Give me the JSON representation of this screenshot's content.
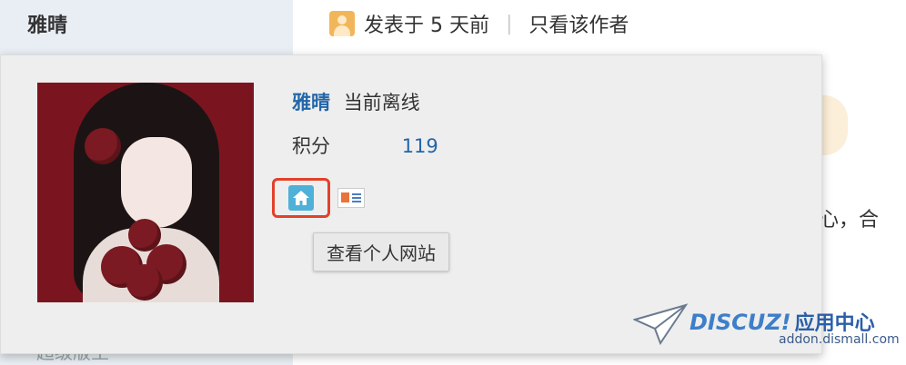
{
  "sidebar": {
    "author_name": "雅晴",
    "bottom_text": "超级版主"
  },
  "post_header": {
    "posted_label": "发表于 5 天前",
    "separator": "|",
    "only_author_link": "只看该作者"
  },
  "content": {
    "snippet": "开心，合"
  },
  "profile_card": {
    "username": "雅晴",
    "online_status": "当前离线",
    "points_label": "积分",
    "points_value": "119",
    "tooltip": "查看个人网站"
  },
  "watermark": {
    "brand": "DISCUZ!",
    "brand_cn": "应用中心",
    "domain": "addon.dismall.com"
  },
  "colors": {
    "link_blue": "#2366a8",
    "highlight_red": "#e2412a",
    "card_bg": "#eeeeee"
  }
}
